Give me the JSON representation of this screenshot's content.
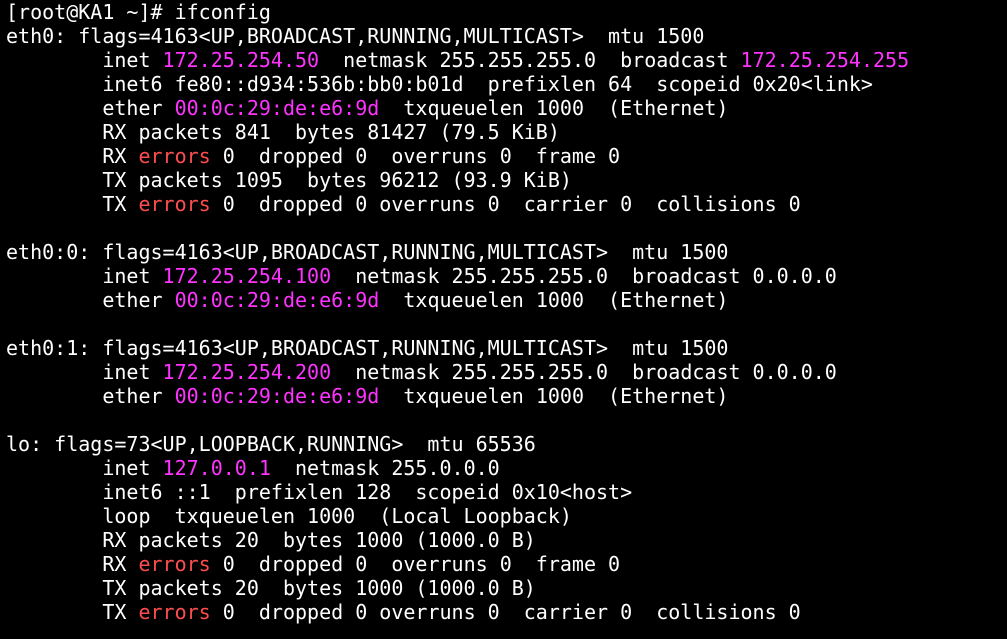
{
  "colors": {
    "background": "#000000",
    "text": "#ffffff",
    "highlight_address": "#ff33ff",
    "highlight_error": "#ff4d4d"
  },
  "terminal": {
    "lines": [
      [
        {
          "t": "[root@KA1 ~]# ifconfig",
          "c": "txt"
        }
      ],
      [
        {
          "t": "eth0: flags=4163<UP,BROADCAST,RUNNING,MULTICAST>  mtu 1500",
          "c": "txt"
        }
      ],
      [
        {
          "t": "        inet ",
          "c": "txt"
        },
        {
          "t": "172.25.254.50",
          "c": "mag"
        },
        {
          "t": "  netmask 255.255.255.0  broadcast ",
          "c": "txt"
        },
        {
          "t": "172.25.254.255",
          "c": "mag"
        }
      ],
      [
        {
          "t": "        inet6 fe80::d934:536b:bb0:b01d  prefixlen 64  scopeid 0x20<link>",
          "c": "txt"
        }
      ],
      [
        {
          "t": "        ether ",
          "c": "txt"
        },
        {
          "t": "00:0c:29:de:e6:9d",
          "c": "mag"
        },
        {
          "t": "  txqueuelen 1000  (Ethernet)",
          "c": "txt"
        }
      ],
      [
        {
          "t": "        RX packets 841  bytes 81427 (79.5 KiB)",
          "c": "txt"
        }
      ],
      [
        {
          "t": "        RX ",
          "c": "txt"
        },
        {
          "t": "errors",
          "c": "err"
        },
        {
          "t": " 0  dropped 0  overruns 0  frame 0",
          "c": "txt"
        }
      ],
      [
        {
          "t": "        TX packets 1095  bytes 96212 (93.9 KiB)",
          "c": "txt"
        }
      ],
      [
        {
          "t": "        TX ",
          "c": "txt"
        },
        {
          "t": "errors",
          "c": "err"
        },
        {
          "t": " 0  dropped 0 overruns 0  carrier 0  collisions 0",
          "c": "txt"
        }
      ],
      [
        {
          "t": "",
          "c": "txt"
        }
      ],
      [
        {
          "t": "eth0:0: flags=4163<UP,BROADCAST,RUNNING,MULTICAST>  mtu 1500",
          "c": "txt"
        }
      ],
      [
        {
          "t": "        inet ",
          "c": "txt"
        },
        {
          "t": "172.25.254.100",
          "c": "mag"
        },
        {
          "t": "  netmask 255.255.255.0  broadcast 0.0.0.0",
          "c": "txt"
        }
      ],
      [
        {
          "t": "        ether ",
          "c": "txt"
        },
        {
          "t": "00:0c:29:de:e6:9d",
          "c": "mag"
        },
        {
          "t": "  txqueuelen 1000  (Ethernet)",
          "c": "txt"
        }
      ],
      [
        {
          "t": "",
          "c": "txt"
        }
      ],
      [
        {
          "t": "eth0:1: flags=4163<UP,BROADCAST,RUNNING,MULTICAST>  mtu 1500",
          "c": "txt"
        }
      ],
      [
        {
          "t": "        inet ",
          "c": "txt"
        },
        {
          "t": "172.25.254.200",
          "c": "mag"
        },
        {
          "t": "  netmask 255.255.255.0  broadcast 0.0.0.0",
          "c": "txt"
        }
      ],
      [
        {
          "t": "        ether ",
          "c": "txt"
        },
        {
          "t": "00:0c:29:de:e6:9d",
          "c": "mag"
        },
        {
          "t": "  txqueuelen 1000  (Ethernet)",
          "c": "txt"
        }
      ],
      [
        {
          "t": "",
          "c": "txt"
        }
      ],
      [
        {
          "t": "lo: flags=73<UP,LOOPBACK,RUNNING>  mtu 65536",
          "c": "txt"
        }
      ],
      [
        {
          "t": "        inet ",
          "c": "txt"
        },
        {
          "t": "127.0.0.1",
          "c": "mag"
        },
        {
          "t": "  netmask 255.0.0.0",
          "c": "txt"
        }
      ],
      [
        {
          "t": "        inet6 ::1  prefixlen 128  scopeid 0x10<host>",
          "c": "txt"
        }
      ],
      [
        {
          "t": "        loop  txqueuelen 1000  (Local Loopback)",
          "c": "txt"
        }
      ],
      [
        {
          "t": "        RX packets 20  bytes 1000 (1000.0 B)",
          "c": "txt"
        }
      ],
      [
        {
          "t": "        RX ",
          "c": "txt"
        },
        {
          "t": "errors",
          "c": "err"
        },
        {
          "t": " 0  dropped 0  overruns 0  frame 0",
          "c": "txt"
        }
      ],
      [
        {
          "t": "        TX packets 20  bytes 1000 (1000.0 B)",
          "c": "txt"
        }
      ],
      [
        {
          "t": "        TX ",
          "c": "txt"
        },
        {
          "t": "errors",
          "c": "err"
        },
        {
          "t": " 0  dropped 0 overruns 0  carrier 0  collisions 0",
          "c": "txt"
        }
      ]
    ]
  }
}
